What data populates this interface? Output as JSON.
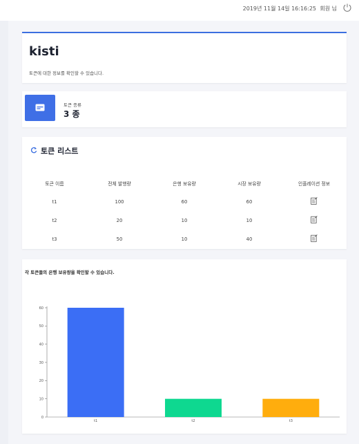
{
  "topbar": {
    "datetime": "2019년 11월 14일 16:16:25",
    "user_label": "회원 님"
  },
  "header": {
    "title": "kisti",
    "description": "토큰에 대한 정보를 확인할 수 있습니다."
  },
  "stat": {
    "label": "토큰 종류",
    "value": "3 종",
    "accent": "#3f6fe6"
  },
  "token_list": {
    "heading": "토큰 리스트",
    "columns": [
      "토큰 이름",
      "전체 발행량",
      "은행 보유량",
      "시장 보유량",
      "인플레이션 정보"
    ],
    "rows": [
      {
        "name": "t1",
        "total": "100",
        "bank": "60",
        "market": "60"
      },
      {
        "name": "t2",
        "total": "20",
        "bank": "10",
        "market": "10"
      },
      {
        "name": "t3",
        "total": "50",
        "bank": "10",
        "market": "40"
      }
    ]
  },
  "chart_card": {
    "caption": "각 토큰들의 은행 보유량을 확인할 수 있습니다."
  },
  "chart_data": {
    "type": "bar",
    "categories": [
      "t1",
      "t2",
      "t3"
    ],
    "values": [
      60,
      10,
      10
    ],
    "colors": [
      "#3b6ef5",
      "#0ed890",
      "#ffad0d"
    ],
    "ylim": [
      0,
      60
    ],
    "yticks": [
      0,
      10,
      20,
      30,
      40,
      50,
      60
    ],
    "xlabel": "",
    "ylabel": "",
    "title": ""
  }
}
